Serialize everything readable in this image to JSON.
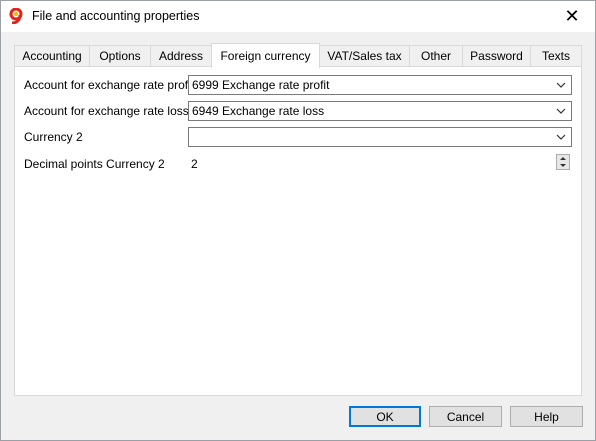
{
  "window": {
    "title": "File and accounting properties",
    "close_glyph": "✕",
    "app_icon": "banana-app-icon"
  },
  "tabs": [
    {
      "label": "Accounting"
    },
    {
      "label": "Options"
    },
    {
      "label": "Address"
    },
    {
      "label": "Foreign currency",
      "active": true
    },
    {
      "label": "VAT/Sales tax"
    },
    {
      "label": "Other"
    },
    {
      "label": "Password"
    },
    {
      "label": "Texts"
    }
  ],
  "form": {
    "profit_label": "Account for exchange rate profit",
    "profit_value": "6999 Exchange rate profit",
    "loss_label": "Account for exchange rate loss",
    "loss_value": "6949 Exchange rate loss",
    "currency2_label": "Currency 2",
    "currency2_value": "",
    "decimals_label": "Decimal points Currency 2",
    "decimals_value": "2"
  },
  "buttons": {
    "ok": "OK",
    "cancel": "Cancel",
    "help": "Help"
  },
  "colors": {
    "default_button_border": "#0078d7",
    "app_icon_red": "#e2231a",
    "app_icon_yellow": "#f5b800"
  }
}
